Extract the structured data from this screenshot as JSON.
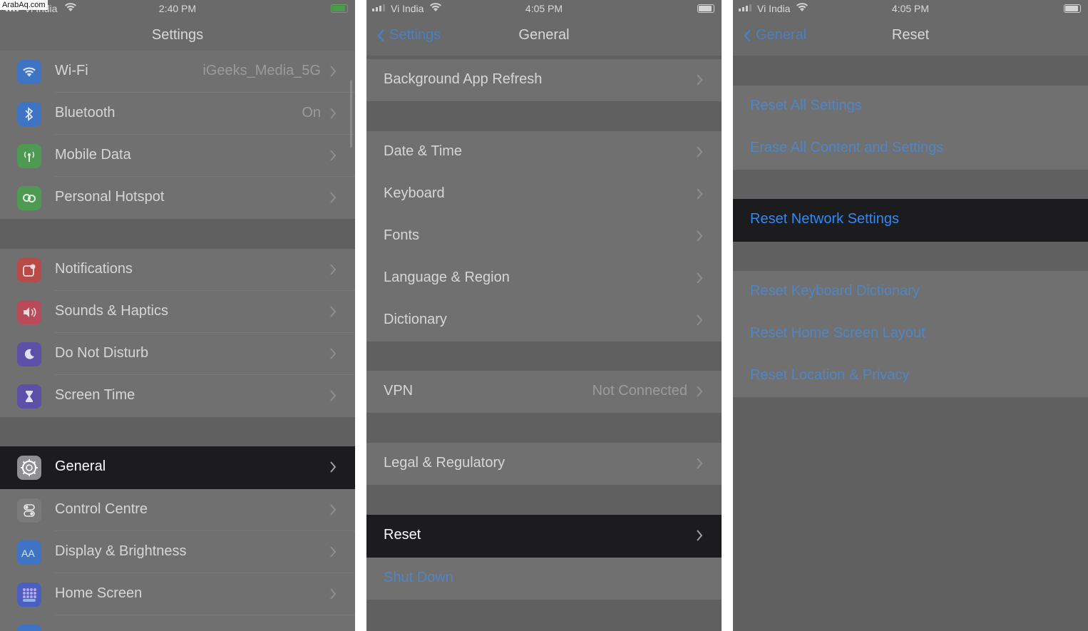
{
  "watermark": "ArabAq.com",
  "panels": [
    {
      "status": {
        "carrier": "Vi India",
        "time": "2:40 PM"
      },
      "title": "Settings",
      "rows": [
        {
          "label": "Wi-Fi",
          "value": "iGeeks_Media_5G",
          "icon": "wifi-icon",
          "icon_color": "#3f74c4"
        },
        {
          "label": "Bluetooth",
          "value": "On",
          "icon": "bluetooth-icon",
          "icon_color": "#3f74c4"
        },
        {
          "label": "Mobile Data",
          "value": "",
          "icon": "antenna-icon",
          "icon_color": "#4f9a52"
        },
        {
          "label": "Personal Hotspot",
          "value": "",
          "icon": "hotspot-icon",
          "icon_color": "#4f9a52"
        },
        {
          "label": "Notifications",
          "value": "",
          "icon": "notifications-icon",
          "icon_color": "#b84a48"
        },
        {
          "label": "Sounds & Haptics",
          "value": "",
          "icon": "speaker-icon",
          "icon_color": "#b84a5a"
        },
        {
          "label": "Do Not Disturb",
          "value": "",
          "icon": "moon-icon",
          "icon_color": "#5b4fa8"
        },
        {
          "label": "Screen Time",
          "value": "",
          "icon": "hourglass-icon",
          "icon_color": "#5b4fa8"
        },
        {
          "label": "General",
          "value": "",
          "icon": "gear-icon",
          "icon_color": "#8e8e93"
        },
        {
          "label": "Control Centre",
          "value": "",
          "icon": "toggles-icon",
          "icon_color": "#7a7a7a"
        },
        {
          "label": "Display & Brightness",
          "value": "",
          "icon": "text-size-icon",
          "icon_color": "#3f74c4"
        },
        {
          "label": "Home Screen",
          "value": "",
          "icon": "grid-icon",
          "icon_color": "#4a5fc0"
        }
      ]
    },
    {
      "status": {
        "carrier": "Vi India",
        "time": "4:05 PM"
      },
      "back": "Settings",
      "title": "General",
      "rows": [
        {
          "label": "Background App Refresh",
          "value": ""
        },
        {
          "label": "Date & Time",
          "value": ""
        },
        {
          "label": "Keyboard",
          "value": ""
        },
        {
          "label": "Fonts",
          "value": ""
        },
        {
          "label": "Language & Region",
          "value": ""
        },
        {
          "label": "Dictionary",
          "value": ""
        },
        {
          "label": "VPN",
          "value": "Not Connected"
        },
        {
          "label": "Legal & Regulatory",
          "value": ""
        },
        {
          "label": "Reset",
          "value": ""
        },
        {
          "label": "Shut Down",
          "value": ""
        }
      ]
    },
    {
      "status": {
        "carrier": "Vi India",
        "time": "4:05 PM"
      },
      "back": "General",
      "title": "Reset",
      "rows": [
        {
          "label": "Reset All Settings"
        },
        {
          "label": "Erase All Content and Settings"
        },
        {
          "label": "Reset Network Settings"
        },
        {
          "label": "Reset Keyboard Dictionary"
        },
        {
          "label": "Reset Home Screen Layout"
        },
        {
          "label": "Reset Location & Privacy"
        }
      ]
    }
  ]
}
